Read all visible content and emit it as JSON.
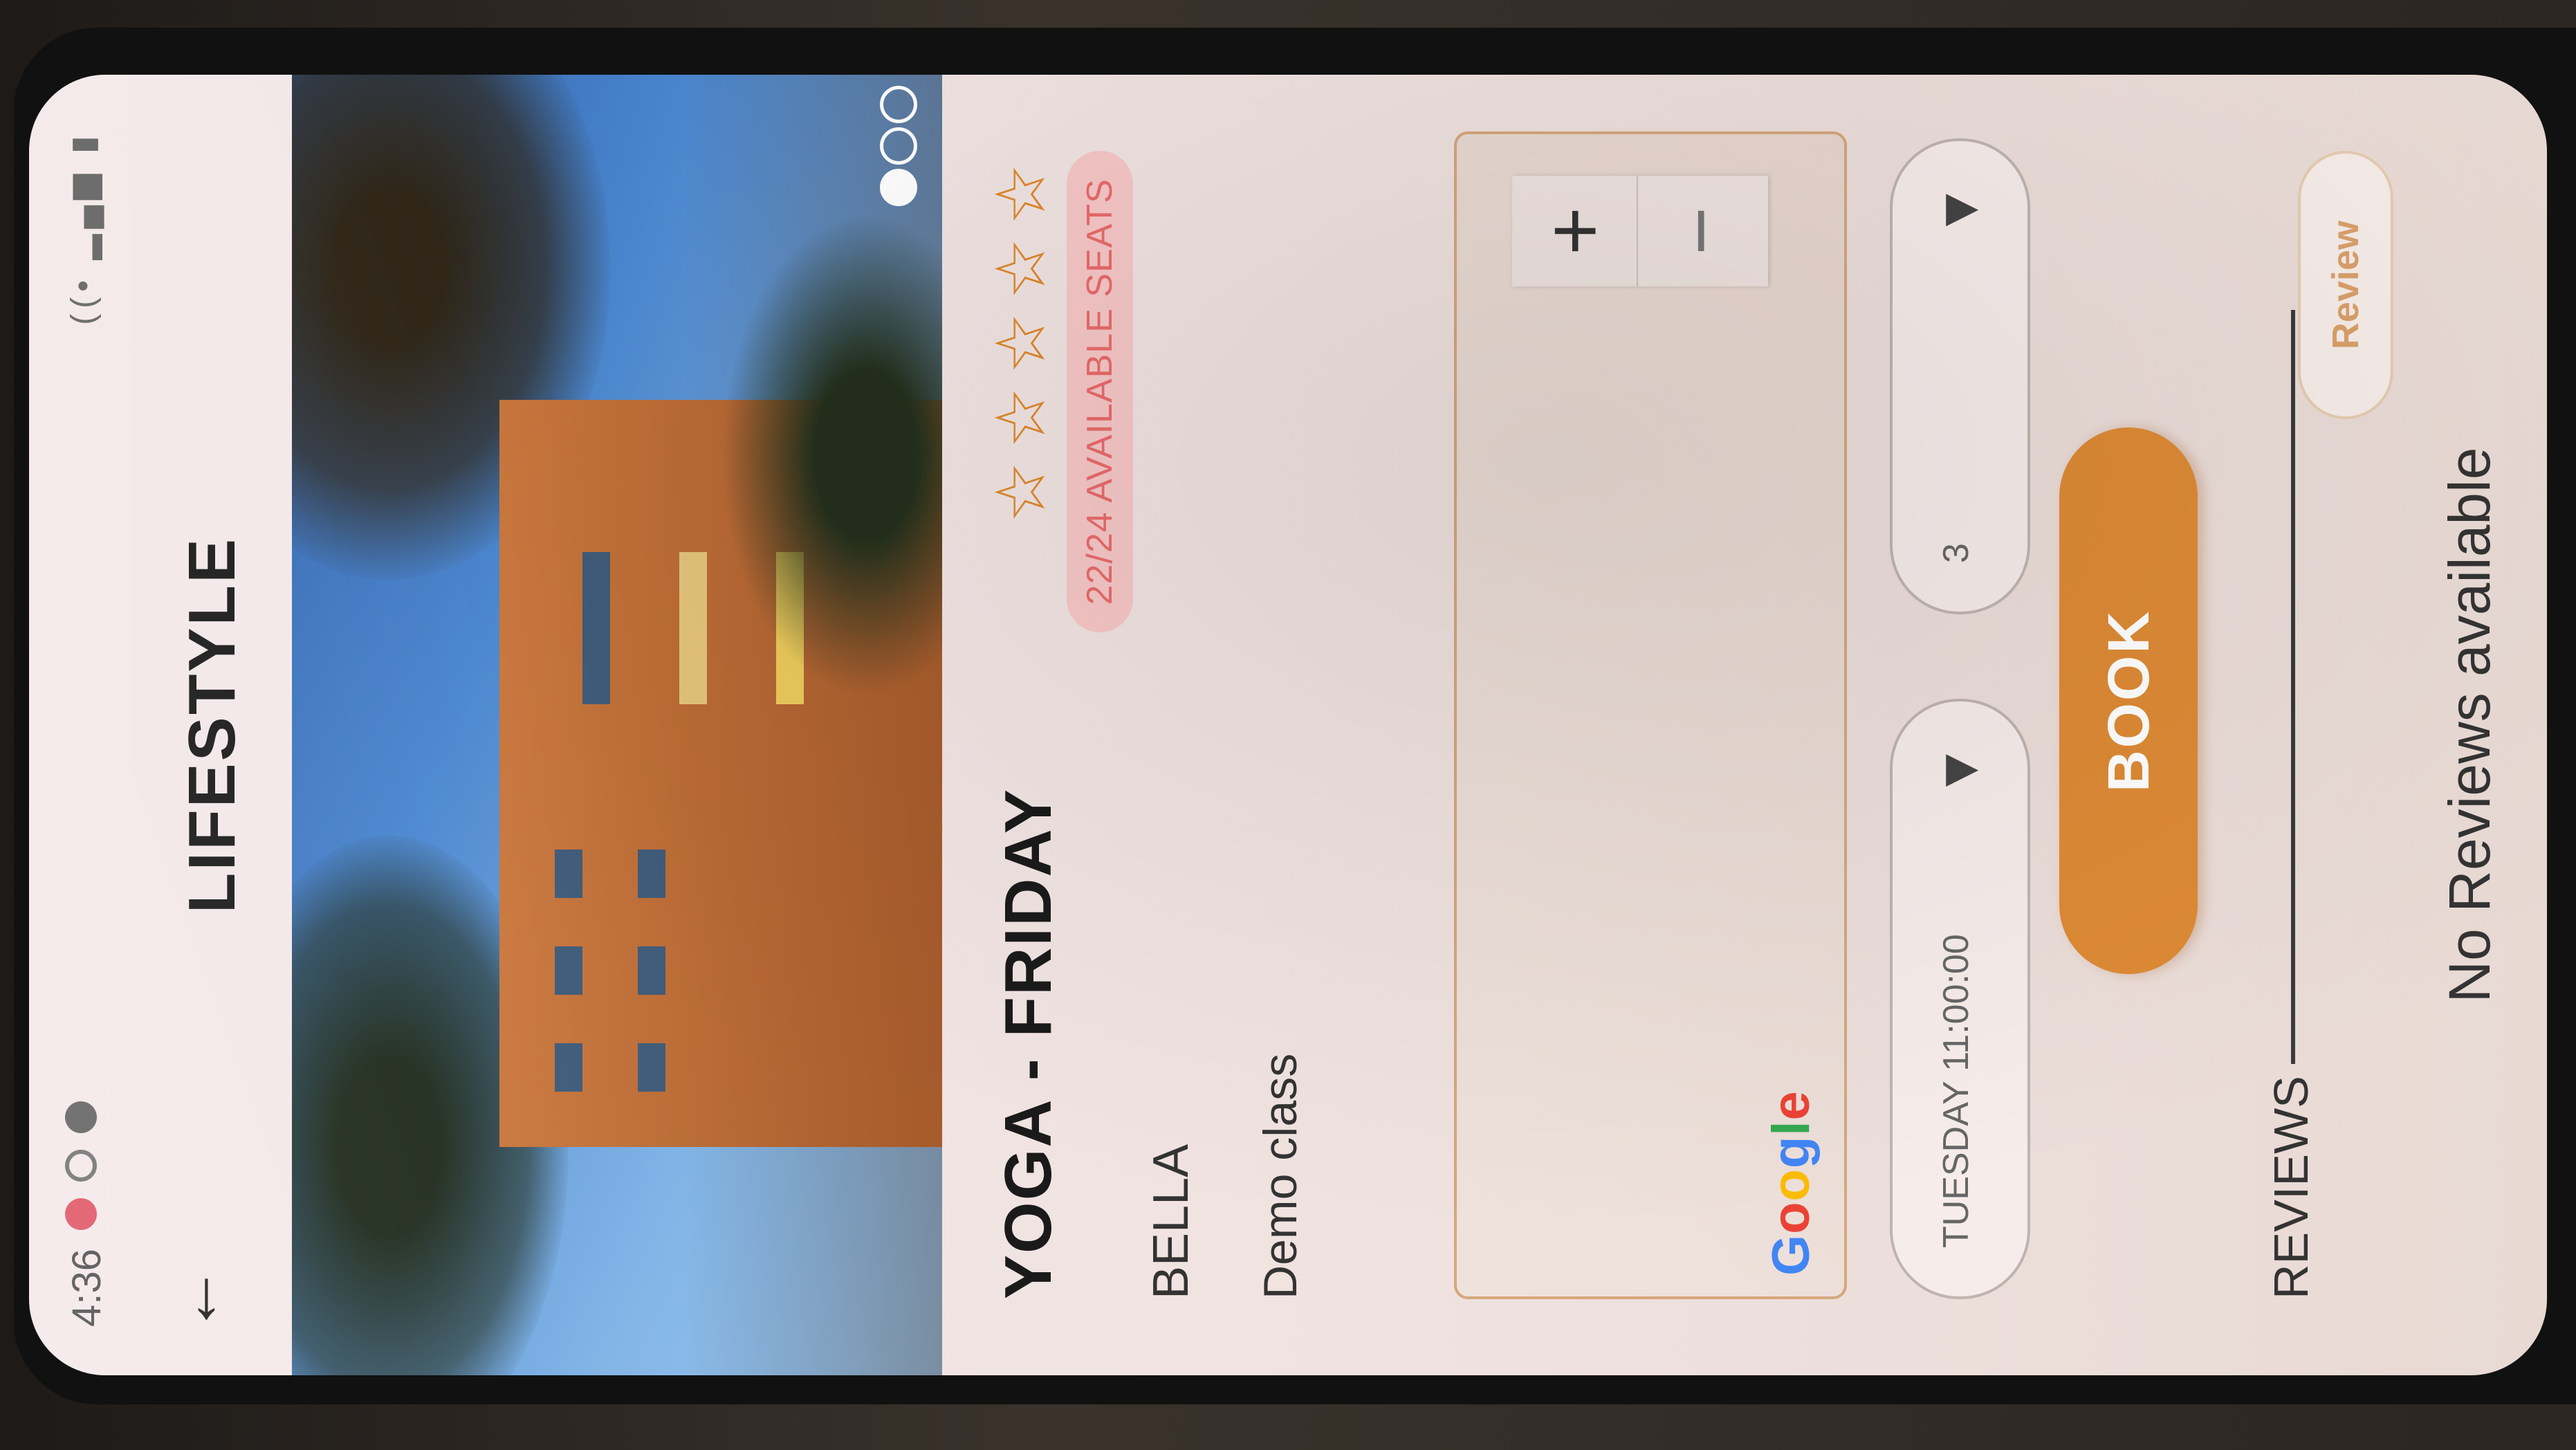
{
  "status_bar": {
    "time": "4:36",
    "icons": [
      "wifi-icon",
      "signal-icon",
      "battery-icon"
    ]
  },
  "app_bar": {
    "title": "LIFESTYLE",
    "back_icon": "←"
  },
  "hero": {
    "pager_count": 3,
    "active_index": 0
  },
  "class": {
    "title": "YOGA - FRIDAY",
    "trainer": "BELLA",
    "description": "Demo class",
    "rating": {
      "value": 0,
      "max": 5
    },
    "seats_badge": "22/24 AVAILABLE SEATS"
  },
  "map": {
    "zoom_in": "+",
    "zoom_out": "−",
    "provider_logo": [
      "G",
      "o",
      "o",
      "g",
      "l",
      "e"
    ],
    "logo_colors": [
      "#4285F4",
      "#EA4335",
      "#FBBC05",
      "#4285F4",
      "#34A853",
      "#EA4335"
    ]
  },
  "booking": {
    "date_value": "TUESDAY 11:00:00",
    "seats_value": "3",
    "dropdown_arrow": "▼",
    "book_label": "BOOK"
  },
  "reviews": {
    "label": "REVIEWS",
    "review_button": "Review",
    "empty_text": "No Reviews available"
  },
  "colors": {
    "accent": "#dd8a35",
    "badge_bg": "#f7c7c7",
    "badge_text": "#ea6b6b",
    "star": "#e0882c"
  }
}
